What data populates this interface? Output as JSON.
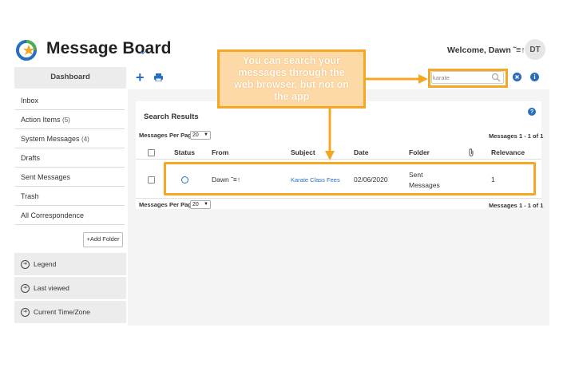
{
  "header": {
    "app_title": "Message Board",
    "welcome": "Welcome, Dawn ˜≡↑",
    "avatar_initials": "DT"
  },
  "sidebar": {
    "dashboard": "Dashboard",
    "items": [
      {
        "label": "Inbox",
        "count": ""
      },
      {
        "label": "Action Items",
        "count": "(5)"
      },
      {
        "label": "System Messages",
        "count": "(4)"
      },
      {
        "label": "Drafts",
        "count": ""
      },
      {
        "label": "Sent Messages",
        "count": ""
      },
      {
        "label": "Trash",
        "count": ""
      },
      {
        "label": "All Correspondence",
        "count": ""
      }
    ],
    "add_folder": "+Add Folder",
    "accordions": [
      "Legend",
      "Last viewed",
      "Current Time/Zone"
    ]
  },
  "search": {
    "value": "karate"
  },
  "results": {
    "title": "Search Results",
    "per_page_label": "Messages Per Page",
    "per_page_value": "20",
    "count_label": "Messages 1 - 1 of 1",
    "columns": [
      "Status",
      "From",
      "Subject",
      "Date",
      "Folder",
      "Relevance"
    ],
    "rows": [
      {
        "from": "Dawn ˜≡↑",
        "subject": "Karate Class Fees",
        "date": "02/06/2020",
        "folder_line1": "Sent",
        "folder_line2": "Messages",
        "relevance": "1"
      }
    ]
  },
  "callout": {
    "lines": [
      "You can search your",
      "messages through the",
      "web browser, but not on",
      "the app"
    ]
  },
  "colors": {
    "accent": "#2a6fbf",
    "highlight": "#f5a623",
    "callout_fill": "#fdd9a8"
  }
}
